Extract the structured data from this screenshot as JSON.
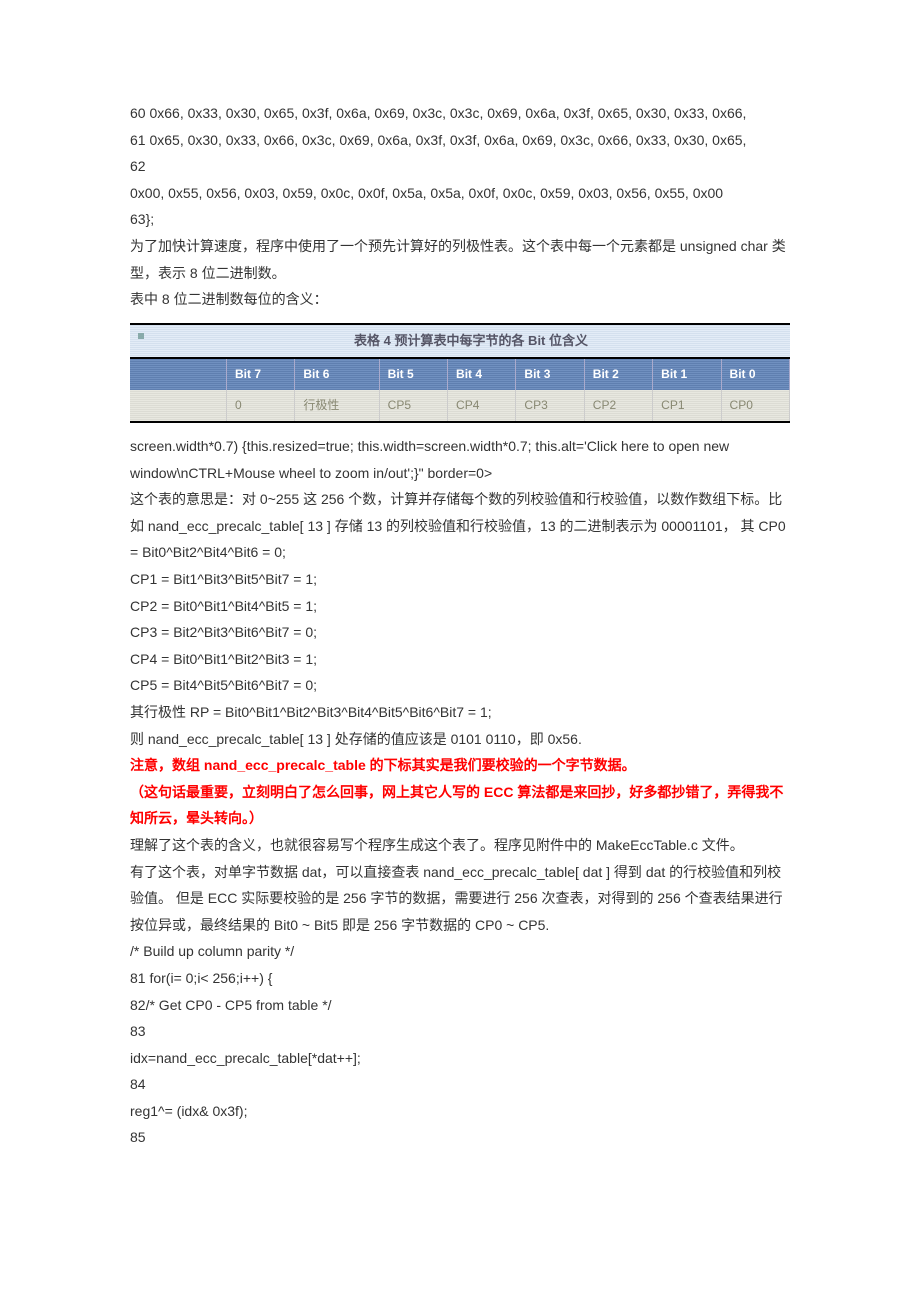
{
  "lines": {
    "l1": "60 0x66, 0x33, 0x30, 0x65, 0x3f, 0x6a, 0x69, 0x3c, 0x3c, 0x69, 0x6a, 0x3f, 0x65, 0x30, 0x33, 0x66,",
    "l2": "61 0x65, 0x30, 0x33, 0x66, 0x3c, 0x69, 0x6a, 0x3f, 0x3f, 0x6a, 0x69, 0x3c, 0x66, 0x33, 0x30, 0x65,",
    "l3": "62",
    "l4": "0x00, 0x55, 0x56, 0x03, 0x59, 0x0c, 0x0f, 0x5a, 0x5a, 0x0f, 0x0c, 0x59, 0x03, 0x56, 0x55, 0x00",
    "l5": "63};",
    "l6": "为了加快计算速度，程序中使用了一个预先计算好的列极性表。这个表中每一个元素都是 unsigned char 类型，表示 8 位二进制数。",
    "l7": "表中 8 位二进制数每位的含义：",
    "l8": "screen.width*0.7) {this.resized=true; this.width=screen.width*0.7; this.alt='Click here to open new window\\nCTRL+Mouse wheel to zoom in/out';}\" border=0>",
    "l9": "这个表的意思是：对 0~255 这 256 个数，计算并存储每个数的列校验值和行校验值，以数作数组下标。比如 nand_ecc_precalc_table[ 13 ] 存储 13 的列校验值和行校验值，13 的二进制表示为 00001101， 其 CP0 = Bit0^Bit2^Bit4^Bit6 = 0;",
    "l10": "CP1 = Bit1^Bit3^Bit5^Bit7 = 1;",
    "l11": "CP2 = Bit0^Bit1^Bit4^Bit5 = 1;",
    "l12": "CP3 = Bit2^Bit3^Bit6^Bit7 = 0;",
    "l13": "CP4 = Bit0^Bit1^Bit2^Bit3 = 1;",
    "l14": "CP5 = Bit4^Bit5^Bit6^Bit7 = 0;",
    "l15": "其行极性 RP = Bit0^Bit1^Bit2^Bit3^Bit4^Bit5^Bit6^Bit7 = 1;",
    "l16": "则 nand_ecc_precalc_table[ 13 ] 处存储的值应该是  0101 0110，即 0x56.",
    "l17": "注意，数组 nand_ecc_precalc_table 的下标其实是我们要校验的一个字节数据。",
    "l18": "（这句话最重要，立刻明白了怎么回事，网上其它人写的 ECC 算法都是来回抄，好多都抄错了，弄得我不知所云，晕头转向。）",
    "l19": "理解了这个表的含义，也就很容易写个程序生成这个表了。程序见附件中的 MakeEccTable.c 文件。",
    "l20": "有了这个表，对单字节数据 dat，可以直接查表 nand_ecc_precalc_table[ dat ]  得到  dat 的行校验值和列校验值。 但是 ECC 实际要校验的是 256 字节的数据，需要进行 256 次查表，对得到的 256 个查表结果进行按位异或，最终结果的  Bit0 ~ Bit5  即是 256 字节数据的  CP0 ~ CP5.",
    "l21": "/* Build up column parity */",
    "l22": "81 for(i= 0;i< 256;i++) {",
    "l23": "82/* Get CP0 - CP5 from table */",
    "l24": "83",
    "l25": "idx=nand_ecc_precalc_table[*dat++];",
    "l26": "84",
    "l27": "reg1^= (idx& 0x3f);",
    "l28": "85"
  },
  "table": {
    "caption": "表格 4   预计算表中每字节的各 Bit 位含义",
    "headers": [
      "",
      "Bit 7",
      "Bit 6",
      "Bit 5",
      "Bit 4",
      "Bit 3",
      "Bit 2",
      "Bit 1",
      "Bit 0"
    ],
    "row": [
      "",
      "0",
      "行极性",
      "CP5",
      "CP4",
      "CP3",
      "CP2",
      "CP1",
      "CP0"
    ]
  }
}
